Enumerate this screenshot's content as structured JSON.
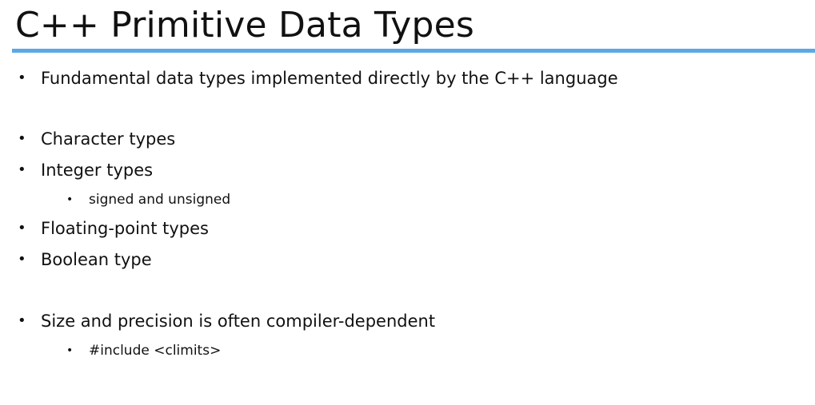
{
  "slide": {
    "title": "C++ Primitive Data Types",
    "accent_color": "#5aa9e6",
    "bullet_glyph": "•",
    "bullets": [
      {
        "level": 1,
        "text": "Fundamental data types implemented directly by the C++ language"
      },
      {
        "level": 1,
        "text": "Character types"
      },
      {
        "level": 1,
        "text": "Integer types"
      },
      {
        "level": 2,
        "text": "signed and unsigned"
      },
      {
        "level": 1,
        "text": "Floating-point types"
      },
      {
        "level": 1,
        "text": "Boolean type"
      },
      {
        "level": 1,
        "text": "Size and precision is often compiler-dependent"
      },
      {
        "level": 2,
        "text": "#include <climits>"
      }
    ]
  }
}
